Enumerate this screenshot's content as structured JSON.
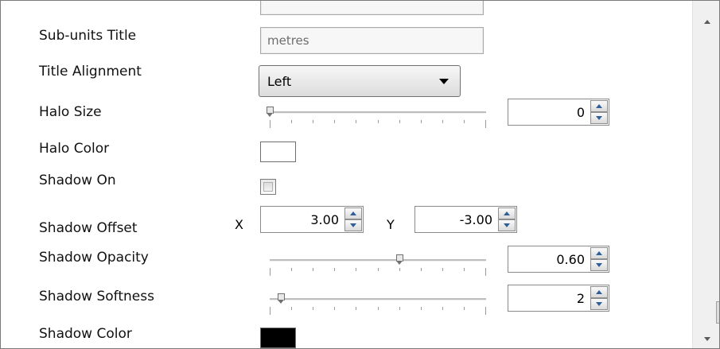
{
  "fields": {
    "subunits_title": {
      "label": "Sub-units Title",
      "value": "metres"
    },
    "title_alignment": {
      "label": "Title Alignment",
      "value": "Left"
    },
    "halo_size": {
      "label": "Halo Size",
      "value": "0",
      "slider_fraction": 0.0
    },
    "halo_color": {
      "label": "Halo Color",
      "color": "#ffffff"
    },
    "shadow_on": {
      "label": "Shadow On",
      "checked": false
    },
    "shadow_offset": {
      "label": "Shadow Offset",
      "x_label": "X",
      "x_value": "3.00",
      "y_label": "Y",
      "y_value": "-3.00"
    },
    "shadow_opacity": {
      "label": "Shadow Opacity",
      "value": "0.60",
      "slider_fraction": 0.6
    },
    "shadow_softness": {
      "label": "Shadow Softness",
      "value": "2",
      "slider_fraction": 0.05
    },
    "shadow_color": {
      "label": "Shadow Color",
      "color": "#000000"
    }
  },
  "scrollbar": {
    "up_icon": "scroll-up-arrow",
    "down_icon": "scroll-down-arrow"
  }
}
